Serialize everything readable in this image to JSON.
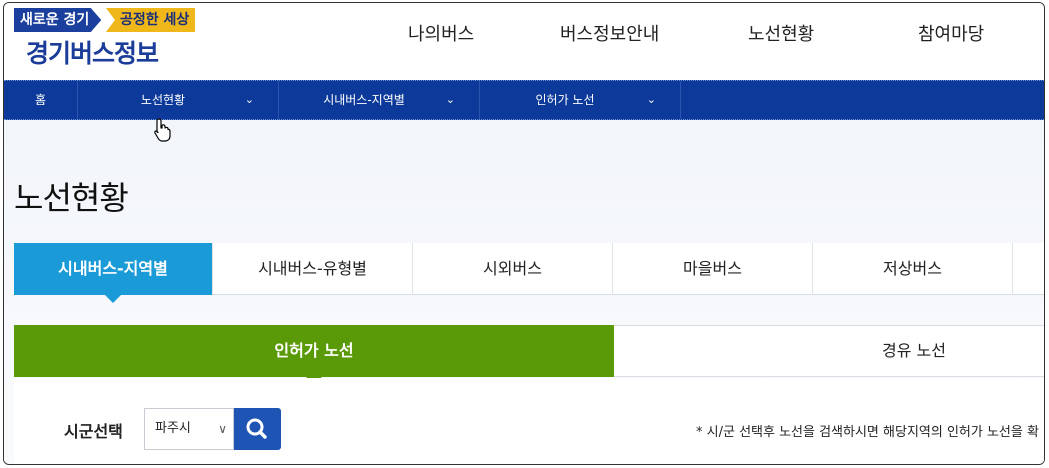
{
  "header": {
    "logo_tag_left": "새로운 경기",
    "logo_tag_right": "공정한 세상",
    "logo_title": "경기버스정보",
    "nav": [
      "나의버스",
      "버스정보안내",
      "노선현황",
      "참여마당"
    ]
  },
  "subnav": {
    "home": "홈",
    "items": [
      "노선현황",
      "시내버스-지역별",
      "인허가 노선"
    ],
    "chevron": "⌄"
  },
  "page": {
    "title": "노선현황"
  },
  "tabs_primary": [
    "시내버스-지역별",
    "시내버스-유형별",
    "시외버스",
    "마을버스",
    "저상버스"
  ],
  "tabs_secondary": [
    "인허가 노선",
    "경유 노선"
  ],
  "search": {
    "label": "시군선택",
    "selected_city": "파주시",
    "notice": "* 시/군 선택후 노선을 검색하시면 해당지역의 인허가 노선을 확"
  },
  "colors": {
    "brand_blue": "#0d3a9a",
    "tab_active": "#1a9ad6",
    "subtab_active": "#5a9a08",
    "search_button": "#1e55b5",
    "logo_yellow": "#f0b71b"
  }
}
